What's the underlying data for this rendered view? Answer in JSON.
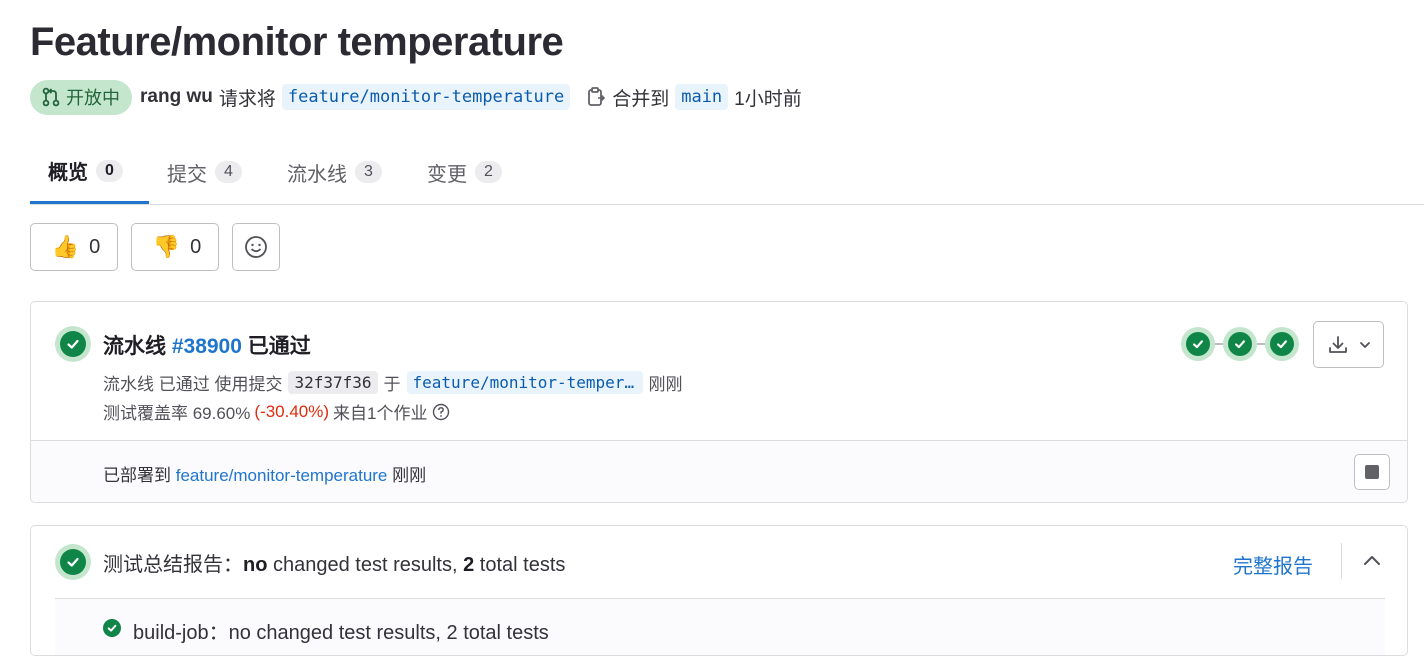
{
  "title": "Feature/monitor temperature",
  "meta": {
    "status": "开放中",
    "author": "rang wu",
    "request_text": "请求将",
    "source_branch": "feature/monitor-temperature",
    "merge_into_text": "合并到",
    "target_branch": "main",
    "time": "1小时前"
  },
  "tabs": [
    {
      "label": "概览",
      "count": "0"
    },
    {
      "label": "提交",
      "count": "4"
    },
    {
      "label": "流水线",
      "count": "3"
    },
    {
      "label": "变更",
      "count": "2"
    }
  ],
  "reactions": {
    "thumbs_up": {
      "emoji": "👍",
      "count": "0"
    },
    "thumbs_down": {
      "emoji": "👎",
      "count": "0"
    }
  },
  "pipeline": {
    "label": "流水线",
    "id": "#38900",
    "status": "已通过",
    "detail_prefix": "流水线 已通过 使用提交",
    "sha": "32f37f36",
    "at_text": "于",
    "branch": "feature/monitor-temperature",
    "when": "刚刚",
    "coverage_label": "测试覆盖率 69.60%",
    "coverage_delta": "(-30.40%)",
    "coverage_source": "来自1个作业",
    "stages_passed": 3,
    "deploy_prefix": "已部署到",
    "deploy_env": "feature/monitor-temperature",
    "deploy_when": "刚刚"
  },
  "tests": {
    "summary_label": "测试总结报告：",
    "summary_no": "no",
    "summary_mid": " changed test results, ",
    "summary_total": "2",
    "summary_end": " total tests",
    "full_report": "完整报告",
    "job_line": "build-job：no changed test results, 2 total tests"
  },
  "colors": {
    "accent": "#1f75cb",
    "success": "#108548",
    "success_bg": "#c3e6cd",
    "danger": "#dd2b0e"
  }
}
